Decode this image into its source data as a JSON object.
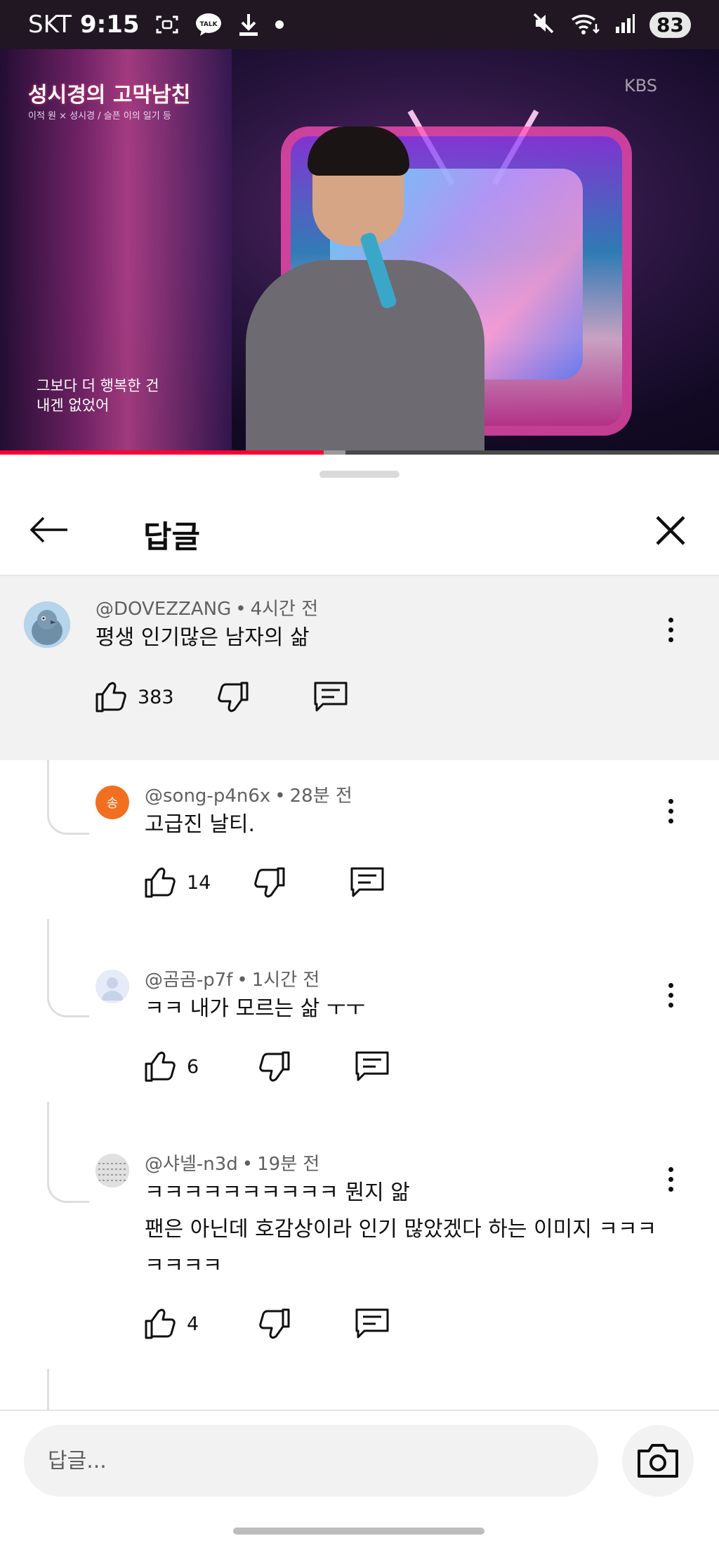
{
  "status_bar": {
    "carrier": "SKT",
    "time": "9:15",
    "talk_badge": "TALK",
    "battery": "83",
    "icons": [
      "screenshot-icon",
      "kakaotalk-icon",
      "download-icon",
      "dot-icon",
      "mute-icon",
      "wifi-icon",
      "signal-icon",
      "battery-icon"
    ]
  },
  "video": {
    "logo": "성시경의 고막남친",
    "logo_sub": "이적 원 × 성시경 / 슬픈 이의 일기 등",
    "channel_mark": "KBS",
    "subtitle_line1": "그보다 더 행복한 건",
    "subtitle_line2": "내겐 없었어",
    "progress": 0.45,
    "buffered": 0.48
  },
  "sheet": {
    "title": "답글",
    "back_icon": "arrow-left-icon",
    "close_icon": "close-icon"
  },
  "parent_comment": {
    "handle": "@DOVEZZANG",
    "time": "4시간 전",
    "text": "평생 인기많은 남자의 삶",
    "likes": "383"
  },
  "replies": [
    {
      "handle": "@song-p4n6x",
      "time": "28분 전",
      "text": "고급진 날티.",
      "likes": "14",
      "avatar_letter": "송",
      "avatar_color": "#f26f21"
    },
    {
      "handle": "@곰곰-p7f",
      "time": "1시간 전",
      "text": "ㅋㅋ  내가 모르는 삶 ㅜㅜ",
      "likes": "6",
      "avatar_color": "#dfe7f5"
    },
    {
      "handle": "@샤넬-n3d",
      "time": "19분 전",
      "text_line1": "ㅋㅋㅋㅋㅋㅋㅋㅋㅋㅋ 뭔지 앎",
      "text_line2": "팬은 아닌데 호감상이라 인기 많았겠다 하는 이미지 ㅋㅋㅋ",
      "text_line3": "ㅋㅋㅋㅋ",
      "likes": "4",
      "avatar_color": "#d8d8d8"
    }
  ],
  "composer": {
    "placeholder": "답글...",
    "camera_icon": "camera-icon"
  },
  "colors": {
    "accent_red": "#ff0033",
    "highlight_bg": "#f2f2f2",
    "text_primary": "#0f0f0f",
    "text_secondary": "#606060"
  }
}
